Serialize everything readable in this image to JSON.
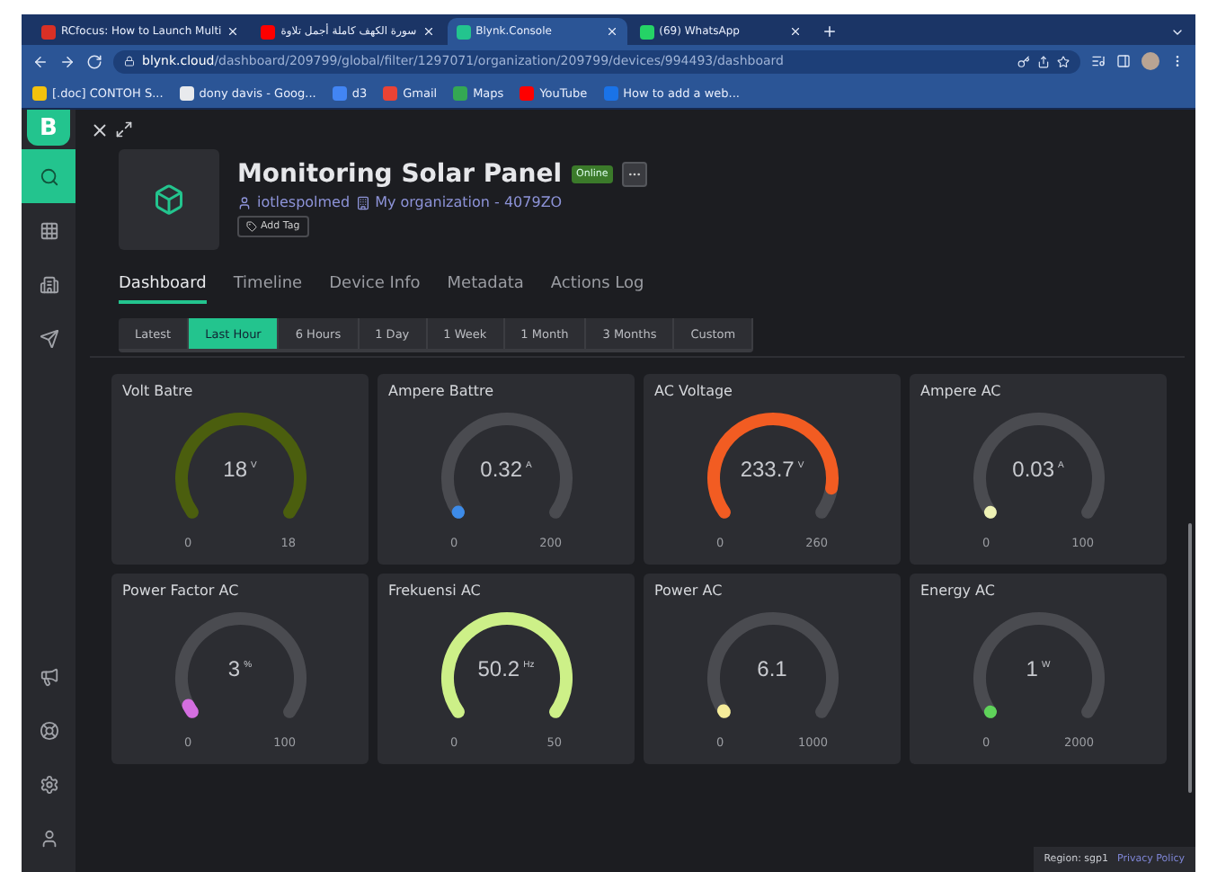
{
  "browser": {
    "tabs": [
      {
        "title": "RCfocus: How to Launch Multi",
        "color": "#d93025",
        "selected": false
      },
      {
        "title": "سورة الكهف كاملة أجمل تلاوة",
        "color": "#ff0000",
        "selected": false
      },
      {
        "title": "Blynk.Console",
        "color": "#23c48e",
        "selected": true
      },
      {
        "title": "(69) WhatsApp",
        "color": "#25d366",
        "selected": false
      }
    ],
    "url_host": "blynk.cloud",
    "url_path": "/dashboard/209799/global/filter/1297071/organization/209799/devices/994493/dashboard",
    "bookmarks": [
      {
        "label": "[.doc] CONTOH S...",
        "color": "#f4c20d"
      },
      {
        "label": "dony davis - Goog...",
        "color": "#e8eaed"
      },
      {
        "label": "d3",
        "color": "#4285f4"
      },
      {
        "label": "Gmail",
        "color": "#ea4335"
      },
      {
        "label": "Maps",
        "color": "#34a853"
      },
      {
        "label": "YouTube",
        "color": "#ff0000"
      },
      {
        "label": "How to add a web...",
        "color": "#1a73e8"
      }
    ]
  },
  "sidebar": {
    "logo": "B",
    "items": [
      {
        "kind": "search",
        "selected": true
      },
      {
        "kind": "grid",
        "selected": false
      },
      {
        "kind": "building",
        "selected": false
      },
      {
        "kind": "send",
        "selected": false
      },
      {
        "kind": "megaphone",
        "selected": false
      },
      {
        "kind": "lifebuoy",
        "selected": false
      },
      {
        "kind": "settings",
        "selected": false
      },
      {
        "kind": "user",
        "selected": false
      }
    ]
  },
  "device": {
    "name": "Monitoring Solar Panel",
    "status": "Online",
    "owner": "iotlespolmed",
    "organization": "My organization - 4079ZO",
    "add_tag": "Add Tag"
  },
  "nav_tabs": [
    {
      "label": "Dashboard",
      "selected": true
    },
    {
      "label": "Timeline",
      "selected": false
    },
    {
      "label": "Device Info",
      "selected": false
    },
    {
      "label": "Metadata",
      "selected": false
    },
    {
      "label": "Actions Log",
      "selected": false
    }
  ],
  "time_ranges": [
    {
      "label": "Latest",
      "selected": false
    },
    {
      "label": "Last Hour",
      "selected": true
    },
    {
      "label": "6 Hours",
      "selected": false
    },
    {
      "label": "1 Day",
      "selected": false
    },
    {
      "label": "1 Week",
      "selected": false
    },
    {
      "label": "1 Month",
      "selected": false
    },
    {
      "label": "3 Months",
      "selected": false
    },
    {
      "label": "Custom",
      "selected": false
    }
  ],
  "widgets": [
    {
      "title": "Volt Batre",
      "value": "18",
      "unit": "V",
      "min": "0",
      "max": "18",
      "color": "#4b5e0e"
    },
    {
      "title": "Ampere Battre",
      "value": "0.32",
      "unit": "A",
      "min": "0",
      "max": "200",
      "color": "#3d8be8"
    },
    {
      "title": "AC Voltage",
      "value": "233.7",
      "unit": "V",
      "min": "0",
      "max": "260",
      "color": "#f25c22"
    },
    {
      "title": "Ampere AC",
      "value": "0.03",
      "unit": "A",
      "min": "0",
      "max": "100",
      "color": "#eef2b5"
    },
    {
      "title": "Power Factor AC",
      "value": "3",
      "unit": "%",
      "min": "0",
      "max": "100",
      "color": "#d46ee0"
    },
    {
      "title": "Frekuensi AC",
      "value": "50.2",
      "unit": "Hz",
      "min": "0",
      "max": "50",
      "color": "#cdf088"
    },
    {
      "title": "Power AC",
      "value": "6.1",
      "min": "0",
      "max": "1000",
      "color": "#f6ec9a"
    },
    {
      "title": "Energy AC",
      "value": "1",
      "unit": "W",
      "min": "0",
      "max": "2000",
      "color": "#5fd35a"
    }
  ],
  "footer": {
    "region": "Region: sgp1",
    "privacy": "Privacy Policy"
  }
}
